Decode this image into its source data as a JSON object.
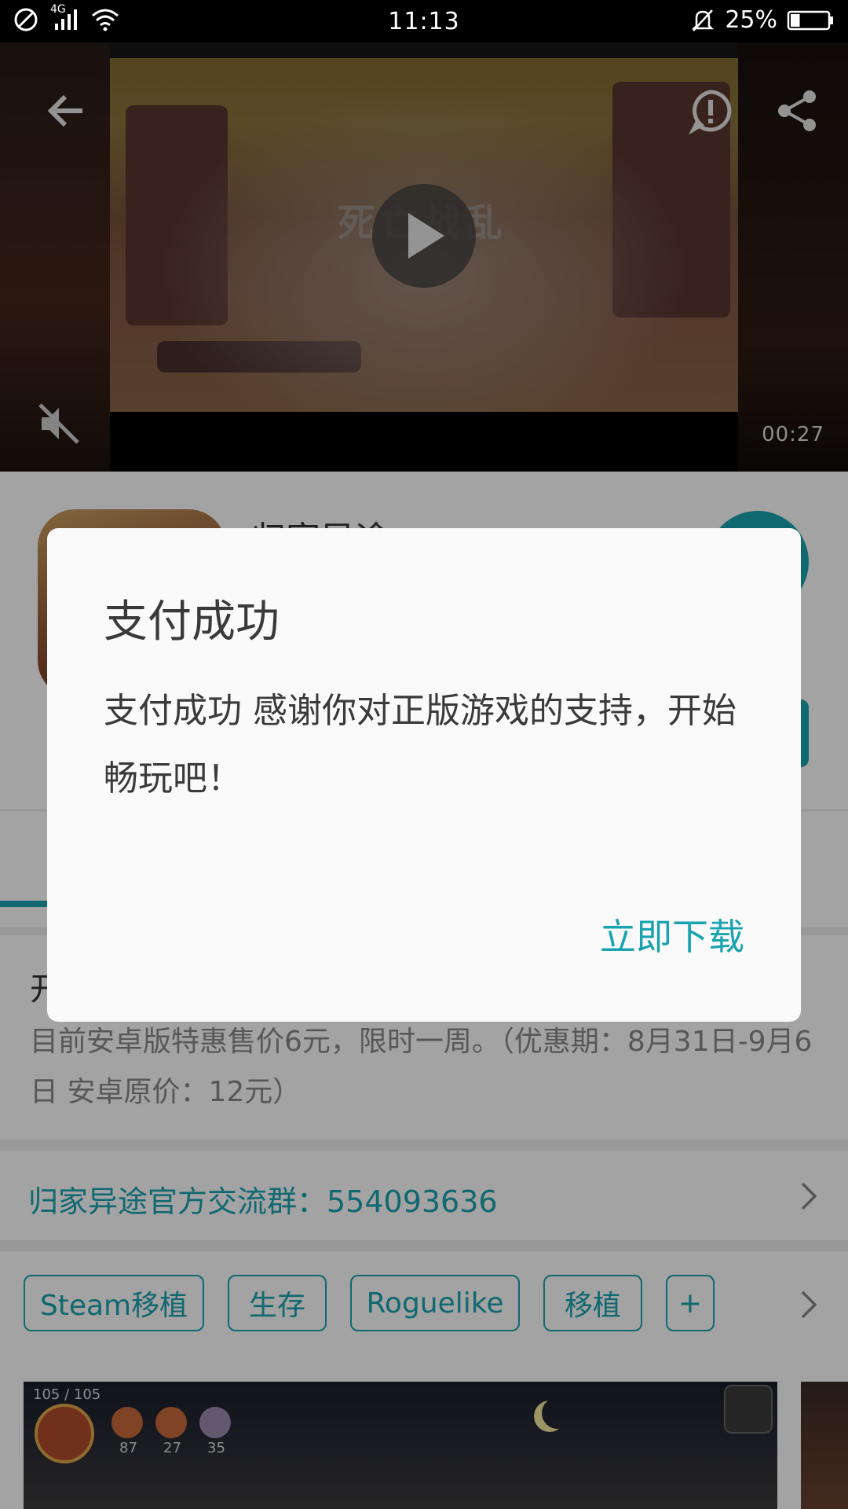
{
  "status_bar": {
    "network": "4G",
    "time": "11:13",
    "battery": "25%",
    "battery_level": 0.25
  },
  "video": {
    "title_art": "死亡战乱",
    "duration": "00:27"
  },
  "app": {
    "name": "归家异途"
  },
  "description": {
    "title": "开",
    "text": "目前安卓版特惠售价6元，限时一周。（优惠期：8月31日-9月6日 安卓原价：12元）"
  },
  "group": {
    "text": "归家异途官方交流群：554093636"
  },
  "tags": [
    "Steam移植",
    "生存",
    "Roguelike",
    "移植",
    "+"
  ],
  "screenshot": {
    "hp": "105 / 105",
    "resources": [
      "87",
      "27",
      "35"
    ]
  },
  "dialog": {
    "title": "支付成功",
    "message": "支付成功 感谢你对正版游戏的支持，开始畅玩吧！",
    "action": "立即下载"
  },
  "colors": {
    "accent": "#19a3b0",
    "scrim": "rgba(0,0,0,0.36)"
  }
}
